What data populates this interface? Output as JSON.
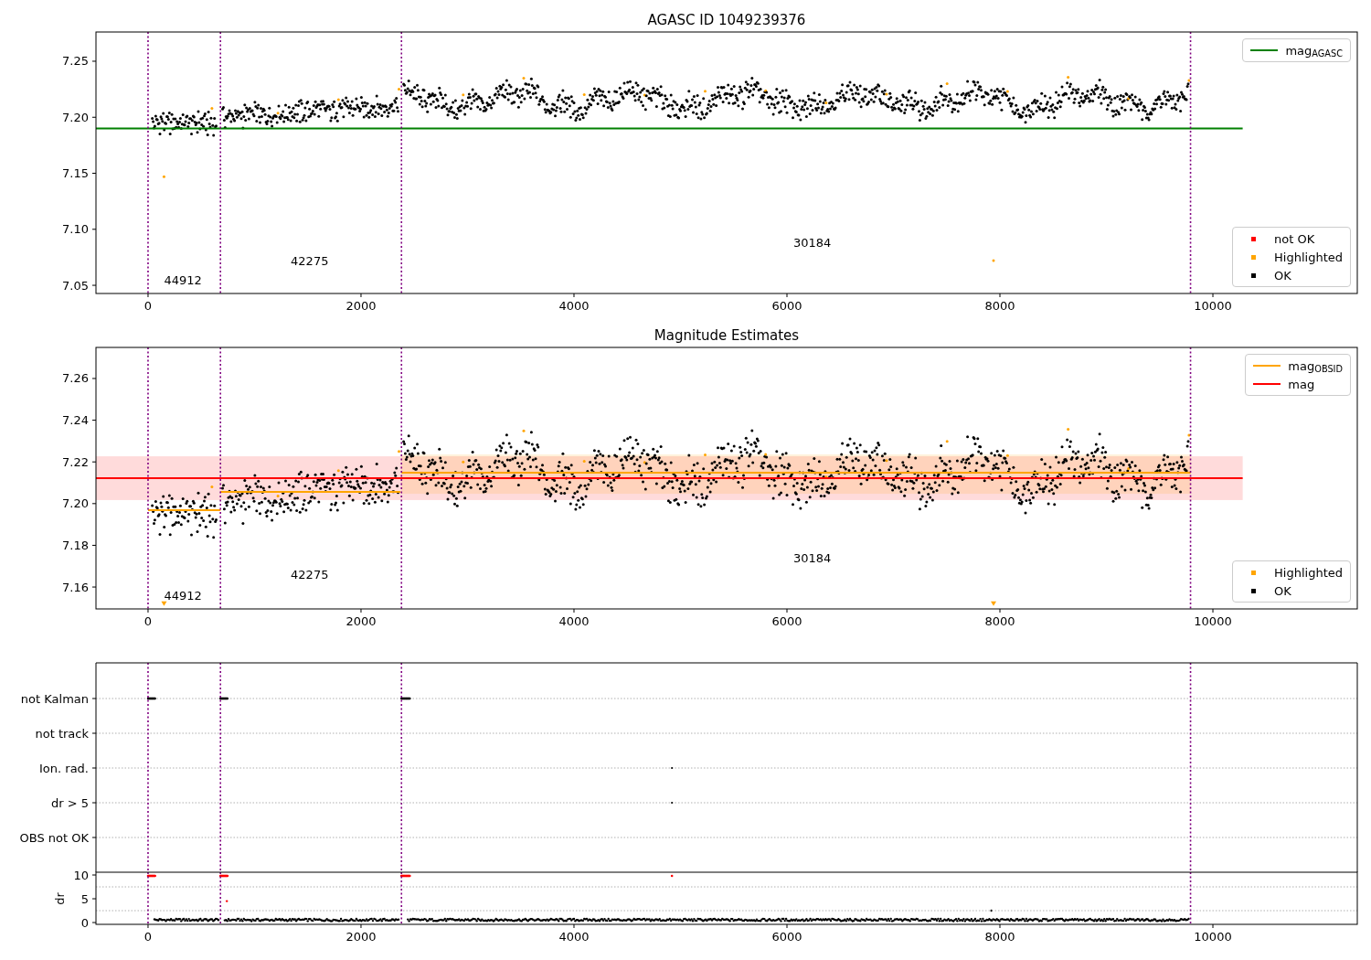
{
  "figure": {
    "panels": [
      {
        "title": "AGASC ID 1049239376",
        "segment_labels": [
          "44912",
          "42275",
          "30184"
        ],
        "chart_data": {
          "type": "scatter",
          "xlim": [
            -489,
            11356
          ],
          "ylim": [
            7.0427,
            7.2761
          ],
          "xticks": [
            0,
            2000,
            4000,
            6000,
            8000,
            10000
          ],
          "yticks": [
            {
              "value": 7.05,
              "label": "7.05"
            },
            {
              "value": 7.1,
              "label": "7.10"
            },
            {
              "value": 7.15,
              "label": "7.15"
            },
            {
              "value": 7.2,
              "label": "7.20"
            },
            {
              "value": 7.25,
              "label": "7.25"
            }
          ],
          "series": [
            {
              "name": "mag$_{AGASC}$",
              "type": "line",
              "color": "#008000",
              "x": [
                -489,
                10280
              ],
              "values": [
                7.19,
                7.19
              ]
            }
          ],
          "ref_lines": [
            {
              "axis": "x",
              "value": 0,
              "color": "#800080"
            },
            {
              "axis": "x",
              "value": 680,
              "color": "#800080"
            },
            {
              "axis": "x",
              "value": 2380,
              "color": "#800080"
            },
            {
              "axis": "x",
              "value": 9790,
              "color": "#800080"
            }
          ]
        },
        "point_legend": [
          {
            "label": "not OK",
            "color": "#ff0000"
          },
          {
            "label": "Highlighted",
            "color": "#ffa500"
          },
          {
            "label": "OK",
            "color": "#000000"
          }
        ]
      },
      {
        "title": "Magnitude Estimates",
        "segment_labels": [
          "44912",
          "42275",
          "30184"
        ],
        "chart_data": {
          "type": "scatter",
          "xlim": [
            -489,
            11356
          ],
          "ylim": [
            7.1495,
            7.2749
          ],
          "xticks": [
            0,
            2000,
            4000,
            6000,
            8000,
            10000
          ],
          "yticks": [
            {
              "value": 7.16,
              "label": "7.16"
            },
            {
              "value": 7.18,
              "label": "7.18"
            },
            {
              "value": 7.2,
              "label": "7.20"
            },
            {
              "value": 7.22,
              "label": "7.22"
            },
            {
              "value": 7.24,
              "label": "7.24"
            },
            {
              "value": 7.26,
              "label": "7.26"
            }
          ],
          "series": [
            {
              "name": "mag$_{OBSID}$",
              "type": "line",
              "color": "#ffa500",
              "x": [
                0,
                680,
                680,
                2370,
                2380,
                9790
              ],
              "values": [
                7.1968,
                7.1968,
                7.2056,
                7.2056,
                7.2148,
                7.2148
              ]
            },
            {
              "name": "mag",
              "type": "line",
              "color": "#ff0000",
              "x": [
                -489,
                10280
              ],
              "values": [
                7.2122,
                7.2122
              ]
            },
            {
              "name": "Highlighted",
              "type": "scatter",
              "color": "#ffa500",
              "x": [
                150,
                7940
              ],
              "values": [
                7.152,
                7.152
              ]
            }
          ],
          "bands": [
            {
              "axis": "y",
              "from": 7.2017,
              "to": 7.2227,
              "color": "#ff0000"
            },
            {
              "axis": "y",
              "from": 7.2047,
              "to": 7.2236,
              "color": "#ffa500"
            }
          ],
          "ref_lines": [
            {
              "axis": "x",
              "value": 0,
              "color": "#800080"
            },
            {
              "axis": "x",
              "value": 680,
              "color": "#800080"
            },
            {
              "axis": "x",
              "value": 2380,
              "color": "#800080"
            },
            {
              "axis": "x",
              "value": 9790,
              "color": "#800080"
            }
          ]
        },
        "point_legend": [
          {
            "label": "OK",
            "color": "#000000"
          }
        ]
      }
    ],
    "flags": {
      "chart_data": {
        "type": "scatter",
        "orientation": "horizontal",
        "xlim": [
          -489,
          11356
        ],
        "categories": [
          "not Kalman",
          "not track",
          "Ion. rad.",
          "dr > 5",
          "OBS not OK"
        ],
        "ref_lines": [
          {
            "axis": "x",
            "value": 0,
            "color": "#800080"
          },
          {
            "axis": "x",
            "value": 680,
            "color": "#800080"
          },
          {
            "axis": "x",
            "value": 2380,
            "color": "#800080"
          },
          {
            "axis": "x",
            "value": 9790,
            "color": "#800080"
          }
        ]
      }
    },
    "dr": {
      "chart_data": {
        "type": "scatter",
        "ylabel": "dr",
        "xlim": [
          -489,
          11356
        ],
        "ylim": [
          -0.38,
          10.58
        ],
        "xticks": [
          0,
          2000,
          4000,
          6000,
          8000,
          10000
        ],
        "yticks": [
          0,
          5,
          10
        ],
        "ref_lines": [
          {
            "axis": "y",
            "value": 2.5,
            "color": "#b0b0b0"
          },
          {
            "axis": "y",
            "value": 7.5,
            "color": "#b0b0b0"
          },
          {
            "axis": "x",
            "value": 0,
            "color": "#800080"
          },
          {
            "axis": "x",
            "value": 680,
            "color": "#800080"
          },
          {
            "axis": "x",
            "value": 2380,
            "color": "#800080"
          },
          {
            "axis": "x",
            "value": 9790,
            "color": "#800080"
          }
        ]
      }
    }
  }
}
